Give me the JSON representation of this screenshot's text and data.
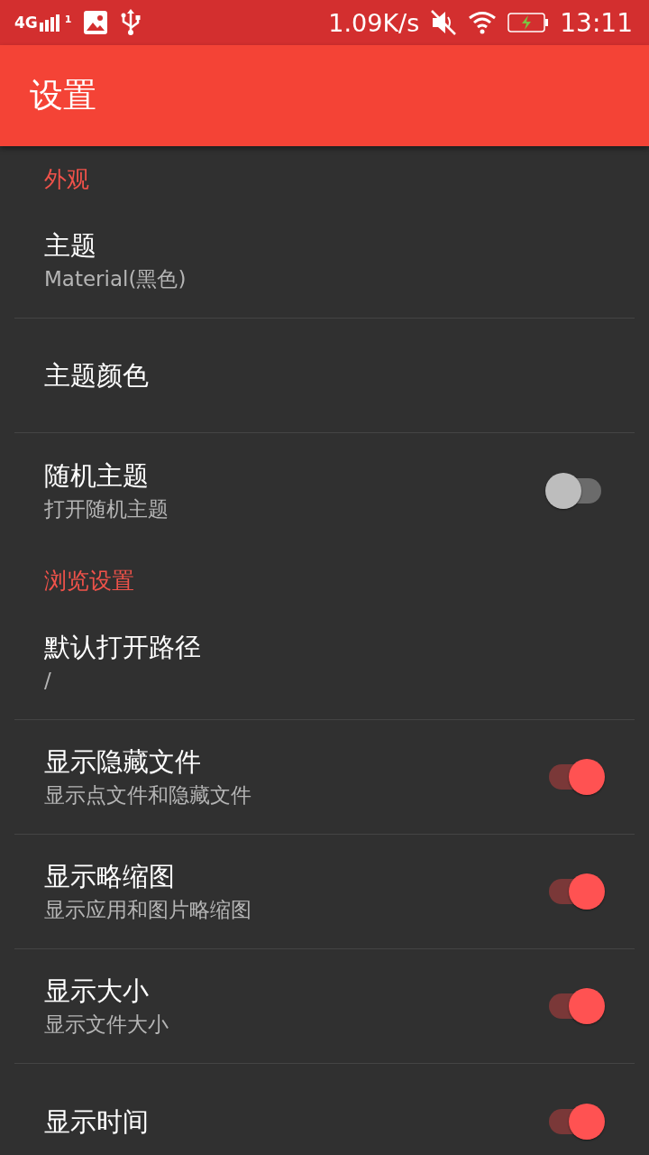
{
  "status_bar": {
    "network": "4G",
    "sim_slot": "1",
    "speed": "1.09K/s",
    "battery_charging": true,
    "time": "13:11"
  },
  "app_bar": {
    "title": "设置"
  },
  "sections": [
    {
      "header": "外观",
      "items": [
        {
          "kind": "text",
          "title": "主题",
          "summary": "Material(黑色)"
        },
        {
          "kind": "text",
          "title": "主题颜色"
        },
        {
          "kind": "switch",
          "title": "随机主题",
          "summary": "打开随机主题",
          "on": false
        }
      ]
    },
    {
      "header": "浏览设置",
      "items": [
        {
          "kind": "text",
          "title": "默认打开路径",
          "summary": "/"
        },
        {
          "kind": "switch",
          "title": "显示隐藏文件",
          "summary": "显示点文件和隐藏文件",
          "on": true
        },
        {
          "kind": "switch",
          "title": "显示略缩图",
          "summary": "显示应用和图片略缩图",
          "on": true
        },
        {
          "kind": "switch",
          "title": "显示大小",
          "summary": "显示文件大小",
          "on": true
        },
        {
          "kind": "switch",
          "title": "显示时间",
          "on": true
        }
      ]
    }
  ]
}
